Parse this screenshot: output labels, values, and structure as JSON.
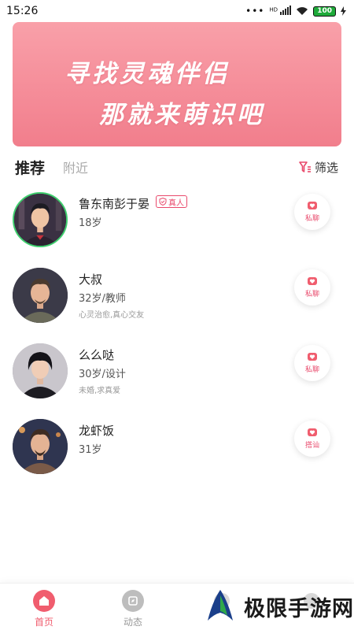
{
  "status_bar": {
    "time": "15:26",
    "network_label": "HD",
    "battery_level": "100"
  },
  "banner": {
    "line1": "寻找灵魂伴侣",
    "line2": "那就来萌识吧"
  },
  "tabs": {
    "active": "推荐",
    "inactive": "附近",
    "filter_label": "筛选"
  },
  "users": [
    {
      "name": "鲁东南彭于晏",
      "badge": "真人",
      "info": "18岁",
      "tagline": "",
      "action": "私聊"
    },
    {
      "name": "大叔",
      "badge": "",
      "info": "32岁/教师",
      "tagline": "心灵治愈,真心交友",
      "action": "私聊"
    },
    {
      "name": "么么哒",
      "badge": "",
      "info": "30岁/设计",
      "tagline": "未婚,求真爱",
      "action": "私聊"
    },
    {
      "name": "龙虾饭",
      "badge": "",
      "info": "31岁",
      "tagline": "",
      "action": "搭讪"
    }
  ],
  "bottom_nav": {
    "home_label": "首页",
    "feed_label": "动态"
  },
  "watermark": {
    "text": "极限手游网"
  },
  "colors": {
    "accent": "#f05d6e",
    "banner_top": "#f9a0a9",
    "banner_bottom": "#f17e8c",
    "verify": "#e94a6c"
  }
}
